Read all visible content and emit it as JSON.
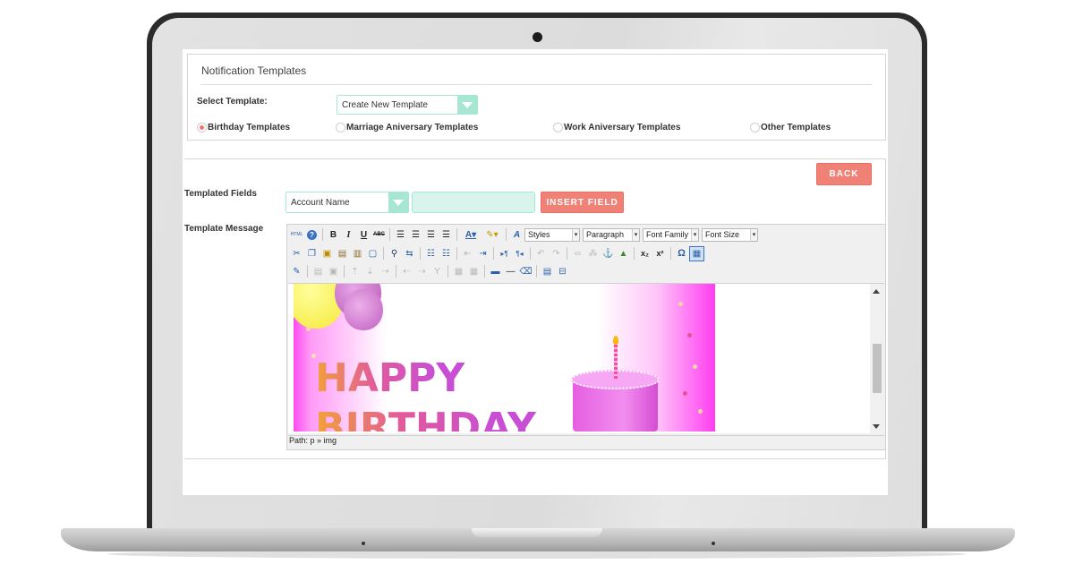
{
  "panel1": {
    "title": "Notification Templates",
    "select_template_label": "Select Template:",
    "select_template_value": "Create New Template",
    "radios": [
      {
        "label": "Birthday Templates",
        "checked": true
      },
      {
        "label": "Marriage Aniversary Templates",
        "checked": false
      },
      {
        "label": "Work Aniversary Templates",
        "checked": false
      },
      {
        "label": "Other Templates",
        "checked": false
      }
    ]
  },
  "panel2": {
    "back_label": "BACK",
    "templated_fields_label": "Templated Fields",
    "templated_fields_value": "Account Name",
    "field_input_value": "",
    "insert_field_label": "INSERT FIELD",
    "template_message_label": "Template Message"
  },
  "editor": {
    "dropdowns": {
      "styles": "Styles",
      "format": "Paragraph",
      "font_family": "Font Family",
      "font_size": "Font Size"
    },
    "toolbar1_labels": {
      "html": "HTML",
      "bold": "B",
      "italic": "I",
      "underline": "U",
      "strike": "ABC"
    },
    "image_text": {
      "line1": "HAPPY",
      "line2": "BIRTHDAY"
    },
    "path": "Path: p » img"
  },
  "colors": {
    "accent_coral": "#f08176",
    "accent_mint": "#a8e6d4",
    "mint_fill": "#d9f4ec",
    "radio_selected": "#f0776b"
  }
}
